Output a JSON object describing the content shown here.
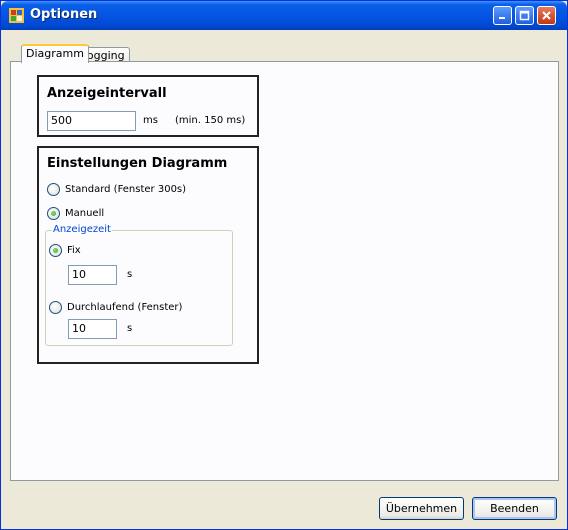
{
  "window": {
    "title": "Optionen"
  },
  "tabs": [
    {
      "label": "Diagramm"
    },
    {
      "label": "Logging"
    }
  ],
  "anzeigeintervall": {
    "title": "Anzeigeintervall",
    "value": "500",
    "unit": "ms",
    "hint": "(min. 150 ms)"
  },
  "einstellungen": {
    "title": "Einstellungen Diagramm",
    "option_standard": "Standard (Fenster 300s)",
    "option_manuell": "Manuell",
    "anzeigezeit": {
      "title": "Anzeigezeit",
      "option_fix": "Fix",
      "fix_value": "10",
      "fix_unit": "s",
      "option_durchlaufend": "Durchlaufend (Fenster)",
      "durchlaufend_value": "10",
      "durchlaufend_unit": "s"
    }
  },
  "buttons": {
    "apply": "Übernehmen",
    "close": "Beenden"
  },
  "colors": {
    "titlebar": "#0554e3",
    "group_border": "#222222",
    "subgroup_title": "#0046d5",
    "radio_checked": "#21a121"
  }
}
